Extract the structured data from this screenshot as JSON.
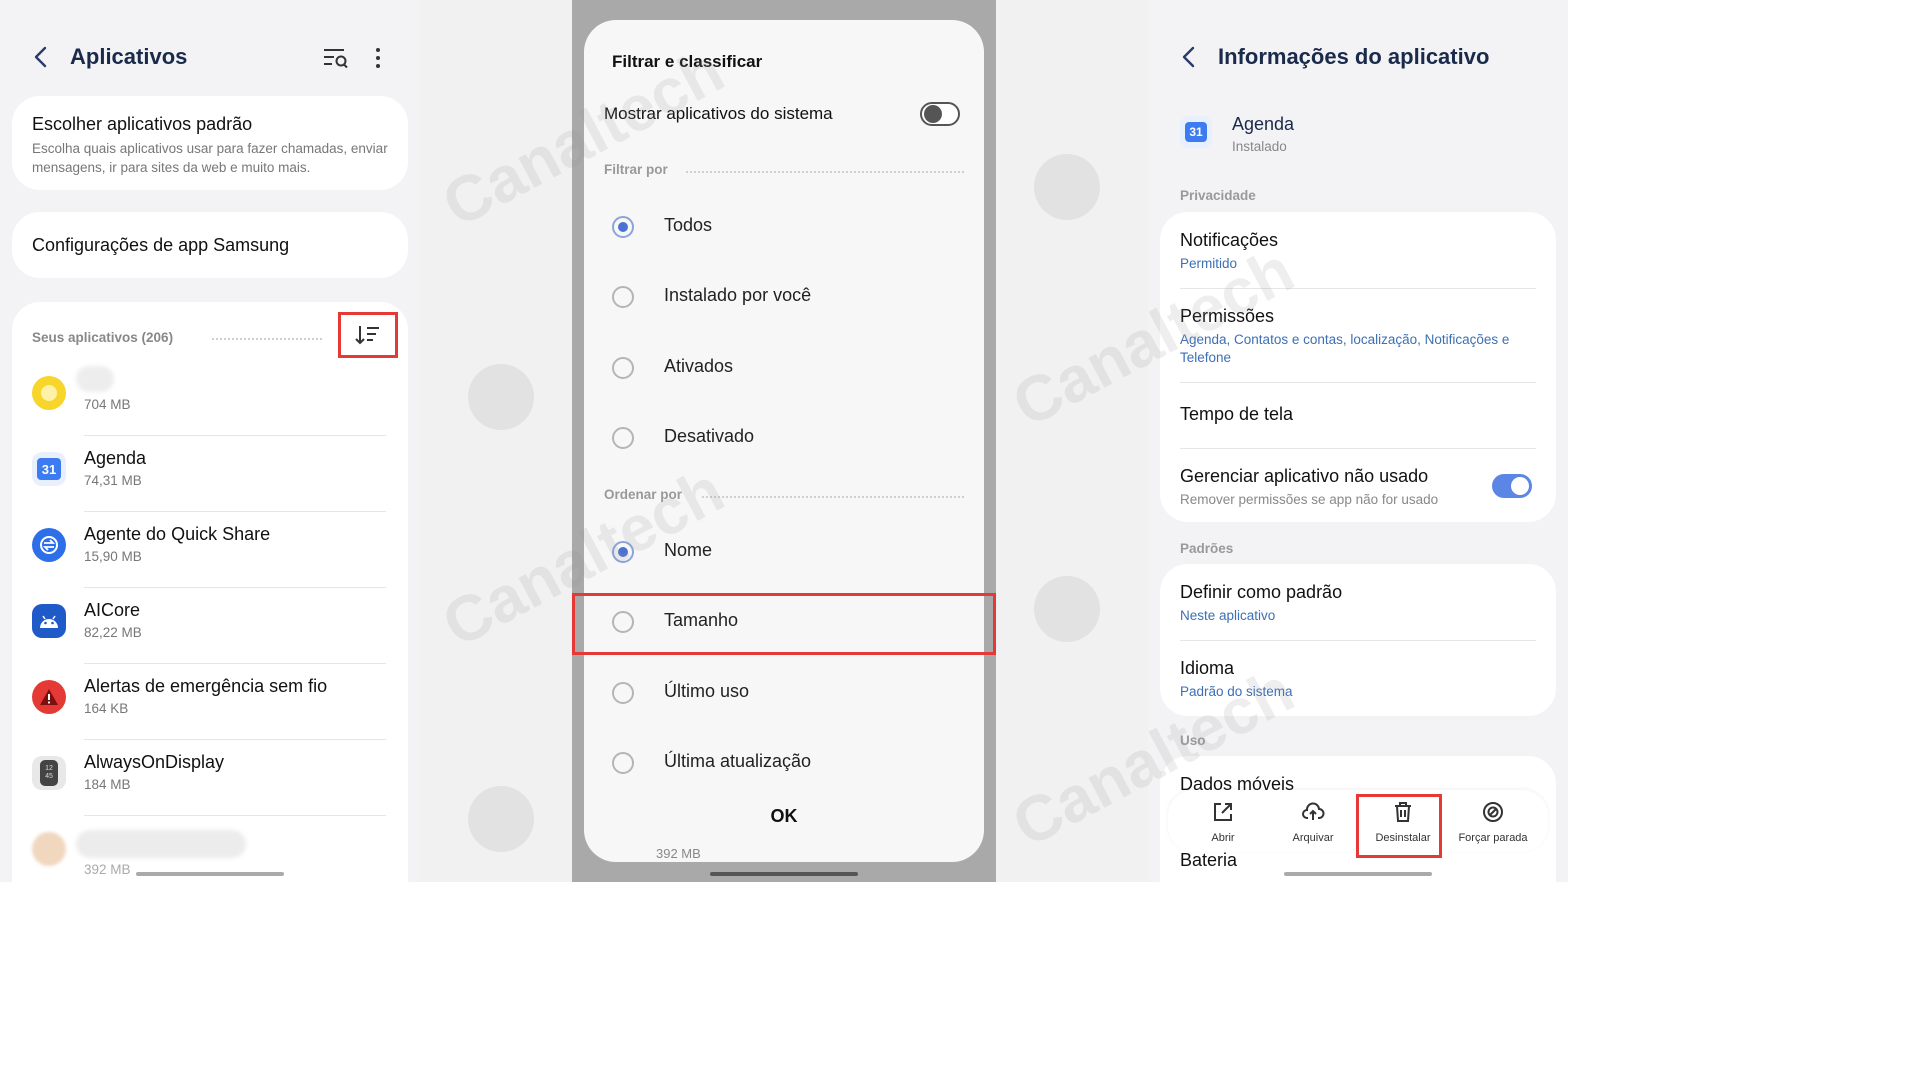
{
  "left": {
    "title": "Aplicativos",
    "default_apps": {
      "title": "Escolher aplicativos padrão",
      "subtitle": "Escolha quais aplicativos usar para fazer chamadas, enviar mensagens, ir para sites da web e muito mais."
    },
    "samsung_settings": "Configurações de app Samsung",
    "apps_header": "Seus aplicativos (206)",
    "apps": [
      {
        "name": "",
        "size": "704 MB",
        "icon": "yellow-circle-icon",
        "color": "#f2c200"
      },
      {
        "name": "Agenda",
        "size": "74,31 MB",
        "icon": "calendar-icon",
        "color": "#3c7bf0"
      },
      {
        "name": "Agente do Quick Share",
        "size": "15,90 MB",
        "icon": "quick-share-icon",
        "color": "#2d6fe8"
      },
      {
        "name": "AICore",
        "size": "82,22 MB",
        "icon": "android-icon",
        "color": "#1f5ac9"
      },
      {
        "name": "Alertas de emergência sem fio",
        "size": "164 KB",
        "icon": "warning-icon",
        "color": "#e53935"
      },
      {
        "name": "AlwaysOnDisplay",
        "size": "184 MB",
        "icon": "clock-display-icon",
        "color": "#555555"
      },
      {
        "name": "",
        "size": "392 MB",
        "icon": "blurred-app-icon",
        "color": "#f0d7be"
      }
    ]
  },
  "dialog": {
    "title": "Filtrar e classificar",
    "system_apps_label": "Mostrar aplicativos do sistema",
    "system_apps_on": false,
    "filter_label": "Filtrar por",
    "filter_options": [
      "Todos",
      "Instalado por você",
      "Ativados",
      "Desativado"
    ],
    "filter_selected": 0,
    "sort_label": "Ordenar por",
    "sort_options": [
      "Nome",
      "Tamanho",
      "Último uso",
      "Última atualização"
    ],
    "sort_selected": 0,
    "ok_label": "OK",
    "behind_size": "392 MB"
  },
  "right": {
    "title": "Informações do aplicativo",
    "app_name": "Agenda",
    "app_status": "Instalado",
    "privacy_label": "Privacidade",
    "notifications": {
      "title": "Notificações",
      "sub": "Permitido"
    },
    "permissions": {
      "title": "Permissões",
      "sub": "Agenda, Contatos e contas, localização, Notificações e Telefone"
    },
    "screen_time": {
      "title": "Tempo de tela"
    },
    "unused": {
      "title": "Gerenciar aplicativo não usado",
      "sub": "Remover permissões se app não for usado",
      "on": true
    },
    "defaults_label": "Padrões",
    "set_default": {
      "title": "Definir como padrão",
      "sub": "Neste aplicativo"
    },
    "language": {
      "title": "Idioma",
      "sub": "Padrão do sistema"
    },
    "usage_label": "Uso",
    "mobile_data": "Dados móveis",
    "battery": "Bateria",
    "actions": [
      {
        "label": "Abrir",
        "icon": "open-external-icon"
      },
      {
        "label": "Arquivar",
        "icon": "cloud-upload-icon"
      },
      {
        "label": "Desinstalar",
        "icon": "trash-icon"
      },
      {
        "label": "Forçar parada",
        "icon": "force-stop-icon"
      }
    ]
  },
  "watermark": "Canaltech",
  "colors": {
    "accent": "#4a73d1",
    "highlight": "#e53935",
    "link": "#3d6fb5"
  }
}
